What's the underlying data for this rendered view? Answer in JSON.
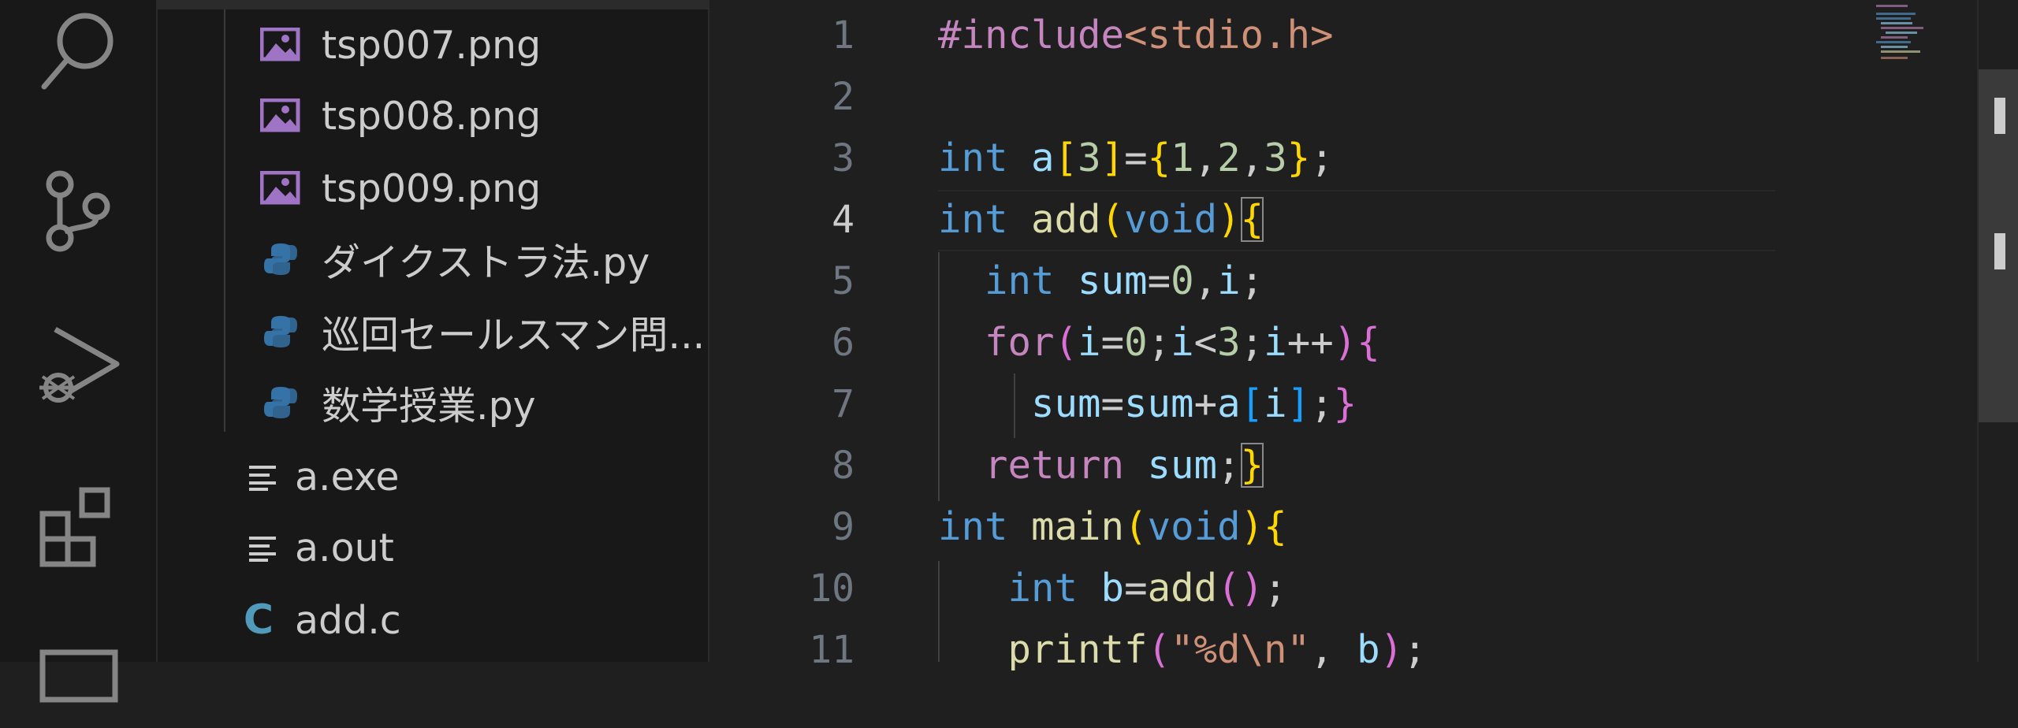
{
  "explorer": {
    "items": [
      {
        "label": "tsp007.png",
        "icon": "image-file-icon"
      },
      {
        "label": "tsp008.png",
        "icon": "image-file-icon"
      },
      {
        "label": "tsp009.png",
        "icon": "image-file-icon"
      },
      {
        "label": "ダイクストラ法.py",
        "icon": "python-file-icon"
      },
      {
        "label": "巡回セールスマン問...",
        "icon": "python-file-icon"
      },
      {
        "label": "数学授業.py",
        "icon": "python-file-icon"
      },
      {
        "label": "a.exe",
        "icon": "text-file-icon"
      },
      {
        "label": "a.out",
        "icon": "text-file-icon"
      },
      {
        "label": "add.c",
        "icon": "c-file-icon",
        "icon_glyph": "C"
      }
    ]
  },
  "editor": {
    "active_line": 4,
    "line_numbers": [
      "1",
      "2",
      "3",
      "4",
      "5",
      "6",
      "7",
      "8",
      "9",
      "10",
      "11"
    ],
    "lines": [
      {
        "t": [
          {
            "c": "inc",
            "v": "#include"
          },
          {
            "c": "str",
            "v": "<stdio.h>"
          }
        ]
      },
      {
        "t": []
      },
      {
        "t": [
          {
            "c": "kw",
            "v": "int"
          },
          {
            "c": "",
            "v": " "
          },
          {
            "c": "var",
            "v": "a"
          },
          {
            "c": "b1",
            "v": "["
          },
          {
            "c": "num",
            "v": "3"
          },
          {
            "c": "b1",
            "v": "]"
          },
          {
            "c": "",
            "v": "="
          },
          {
            "c": "b1",
            "v": "{"
          },
          {
            "c": "num",
            "v": "1"
          },
          {
            "c": "",
            "v": ","
          },
          {
            "c": "num",
            "v": "2"
          },
          {
            "c": "",
            "v": ","
          },
          {
            "c": "num",
            "v": "3"
          },
          {
            "c": "b1",
            "v": "}"
          },
          {
            "c": "",
            "v": ";"
          }
        ]
      },
      {
        "t": [
          {
            "c": "kw",
            "v": "int"
          },
          {
            "c": "",
            "v": " "
          },
          {
            "c": "fn",
            "v": "add"
          },
          {
            "c": "b1",
            "v": "("
          },
          {
            "c": "kw",
            "v": "void"
          },
          {
            "c": "b1",
            "v": ")"
          },
          {
            "c": "b1 bm",
            "v": "{"
          }
        ]
      },
      {
        "t": [
          {
            "c": "",
            "v": "  "
          },
          {
            "c": "kw",
            "v": "int"
          },
          {
            "c": "",
            "v": " "
          },
          {
            "c": "var",
            "v": "sum"
          },
          {
            "c": "",
            "v": "="
          },
          {
            "c": "num",
            "v": "0"
          },
          {
            "c": "",
            "v": ","
          },
          {
            "c": "var",
            "v": "i"
          },
          {
            "c": "",
            "v": ";"
          }
        ]
      },
      {
        "t": [
          {
            "c": "",
            "v": "  "
          },
          {
            "c": "ctl",
            "v": "for"
          },
          {
            "c": "b2",
            "v": "("
          },
          {
            "c": "var",
            "v": "i"
          },
          {
            "c": "",
            "v": "="
          },
          {
            "c": "num",
            "v": "0"
          },
          {
            "c": "",
            "v": ";"
          },
          {
            "c": "var",
            "v": "i"
          },
          {
            "c": "",
            "v": "<"
          },
          {
            "c": "num",
            "v": "3"
          },
          {
            "c": "",
            "v": ";"
          },
          {
            "c": "var",
            "v": "i"
          },
          {
            "c": "",
            "v": "++"
          },
          {
            "c": "b2",
            "v": ")"
          },
          {
            "c": "b2",
            "v": "{"
          }
        ]
      },
      {
        "t": [
          {
            "c": "",
            "v": "    "
          },
          {
            "c": "var",
            "v": "sum"
          },
          {
            "c": "",
            "v": "="
          },
          {
            "c": "var",
            "v": "sum"
          },
          {
            "c": "",
            "v": "+"
          },
          {
            "c": "var",
            "v": "a"
          },
          {
            "c": "b3",
            "v": "["
          },
          {
            "c": "var",
            "v": "i"
          },
          {
            "c": "b3",
            "v": "]"
          },
          {
            "c": "",
            "v": ";"
          },
          {
            "c": "b2",
            "v": "}"
          }
        ]
      },
      {
        "t": [
          {
            "c": "",
            "v": "  "
          },
          {
            "c": "ctl",
            "v": "return"
          },
          {
            "c": "",
            "v": " "
          },
          {
            "c": "var",
            "v": "sum"
          },
          {
            "c": "",
            "v": ";"
          },
          {
            "c": "b1 bm",
            "v": "}"
          }
        ]
      },
      {
        "t": [
          {
            "c": "kw",
            "v": "int"
          },
          {
            "c": "",
            "v": " "
          },
          {
            "c": "fn",
            "v": "main"
          },
          {
            "c": "b1",
            "v": "("
          },
          {
            "c": "kw",
            "v": "void"
          },
          {
            "c": "b1",
            "v": ")"
          },
          {
            "c": "b1",
            "v": "{"
          }
        ]
      },
      {
        "t": [
          {
            "c": "",
            "v": "   "
          },
          {
            "c": "kw",
            "v": "int"
          },
          {
            "c": "",
            "v": " "
          },
          {
            "c": "var",
            "v": "b"
          },
          {
            "c": "",
            "v": "="
          },
          {
            "c": "fn",
            "v": "add"
          },
          {
            "c": "b2",
            "v": "("
          },
          {
            "c": "b2",
            "v": ")"
          },
          {
            "c": "",
            "v": ";"
          }
        ]
      },
      {
        "t": [
          {
            "c": "",
            "v": "   "
          },
          {
            "c": "fn",
            "v": "printf"
          },
          {
            "c": "b2",
            "v": "("
          },
          {
            "c": "str",
            "v": "\"%d\\n\""
          },
          {
            "c": "",
            "v": ","
          },
          {
            "c": "var",
            "v": " b"
          },
          {
            "c": "b2",
            "v": ")"
          },
          {
            "c": "",
            "v": ";"
          }
        ]
      }
    ]
  },
  "colors": {
    "activity_icon": "#858585",
    "image_icon": "#a074c4",
    "python_blue": "#3572a5",
    "python_yellow": "#ffd43b"
  }
}
